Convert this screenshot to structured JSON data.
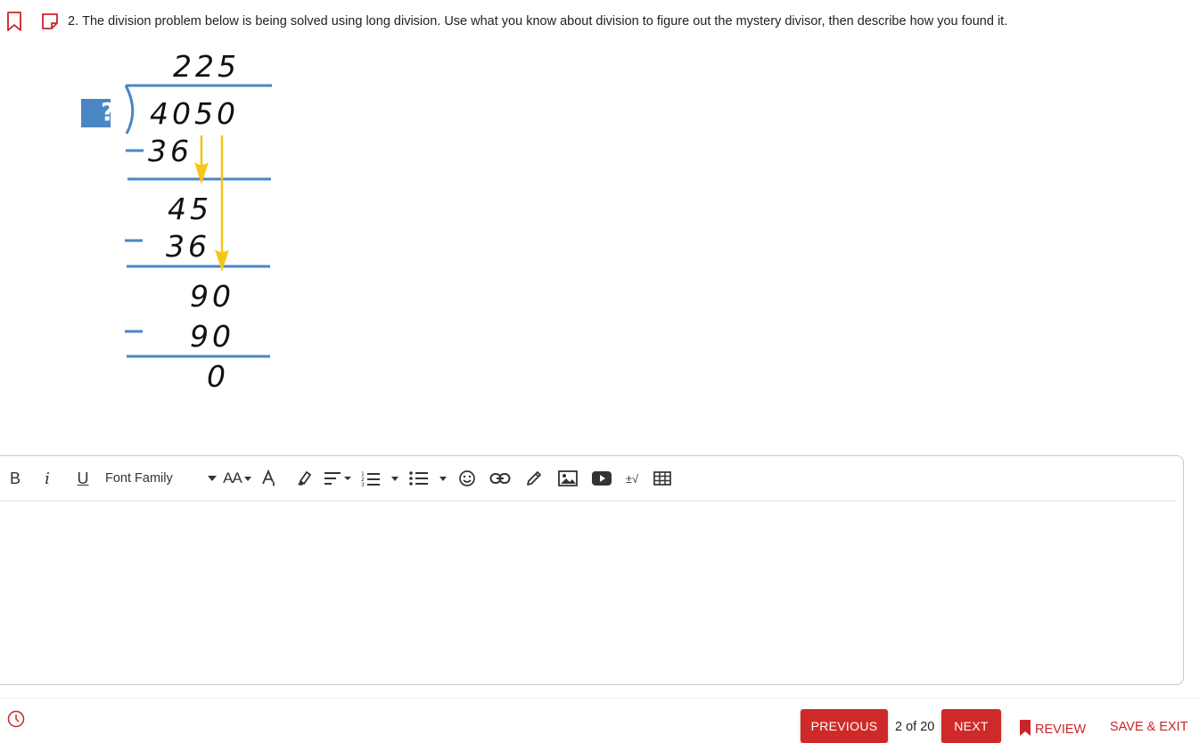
{
  "question": {
    "number": "2.",
    "text": "The division problem below is being solved using long division. Use what you know about division to figure out the mystery divisor, then describe how you found it."
  },
  "division": {
    "mystery_symbol": "?",
    "quotient": "225",
    "dividend": "4050",
    "steps": [
      {
        "subtract": "36",
        "result": "45"
      },
      {
        "subtract": "36",
        "result": "90"
      },
      {
        "subtract": "90",
        "result": "0"
      }
    ],
    "colors": {
      "line": "#4a86c5",
      "arrow": "#f5c518",
      "box": "#4a86c5"
    }
  },
  "toolbar": {
    "bold": "B",
    "italic": "i",
    "underline": "U",
    "font_family": "Font Family",
    "font_size": "AA",
    "math": "±√",
    "icons": [
      "text-color-icon",
      "highlight-icon",
      "align-icon",
      "ordered-list-icon",
      "bullet-list-icon",
      "emoji-icon",
      "link-icon",
      "draw-icon",
      "image-icon",
      "video-icon",
      "math-icon",
      "table-icon"
    ]
  },
  "footer": {
    "previous": "PREVIOUS",
    "page": "2 of 20",
    "next": "NEXT",
    "review": "REVIEW",
    "save_exit": "SAVE & EXIT",
    "accent": "#cf2a2a"
  }
}
